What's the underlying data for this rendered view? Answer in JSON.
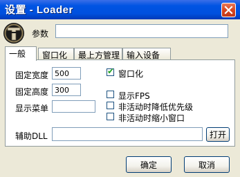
{
  "window": {
    "title": "设置 - Loader"
  },
  "params": {
    "label": "参数",
    "value": ""
  },
  "tabs": [
    {
      "label": "一般",
      "active": true
    },
    {
      "label": "窗口化",
      "active": false
    },
    {
      "label": "最上方管理",
      "active": false
    },
    {
      "label": "输入设备",
      "active": false
    }
  ],
  "general": {
    "fixed_width_label": "固定宽度",
    "fixed_width_value": "500",
    "fixed_height_label": "固定高度",
    "fixed_height_value": "300",
    "show_menu_label": "显示菜单",
    "show_menu_value": "",
    "windowed_label": "窗口化",
    "windowed_checked": true,
    "show_fps_label": "显示FPS",
    "show_fps_checked": false,
    "lower_priority_label": "非活动时降低优先级",
    "lower_priority_checked": false,
    "minimize_window_label": "非活动时缩小窗口",
    "minimize_window_checked": false
  },
  "aux_dll": {
    "label": "辅助DLL",
    "value": "",
    "open_label": "打开"
  },
  "buttons": {
    "ok_label": "确定",
    "cancel_label": "取消"
  },
  "colors": {
    "titlebar": "#0054e3",
    "window_bg": "#ece9d8",
    "close_button": "#d8451f",
    "checkmark": "#21a121",
    "input_border": "#7f9db9"
  },
  "icons": {
    "app": "tekken-logo-icon",
    "close": "close-icon",
    "check": "checkmark-icon"
  }
}
